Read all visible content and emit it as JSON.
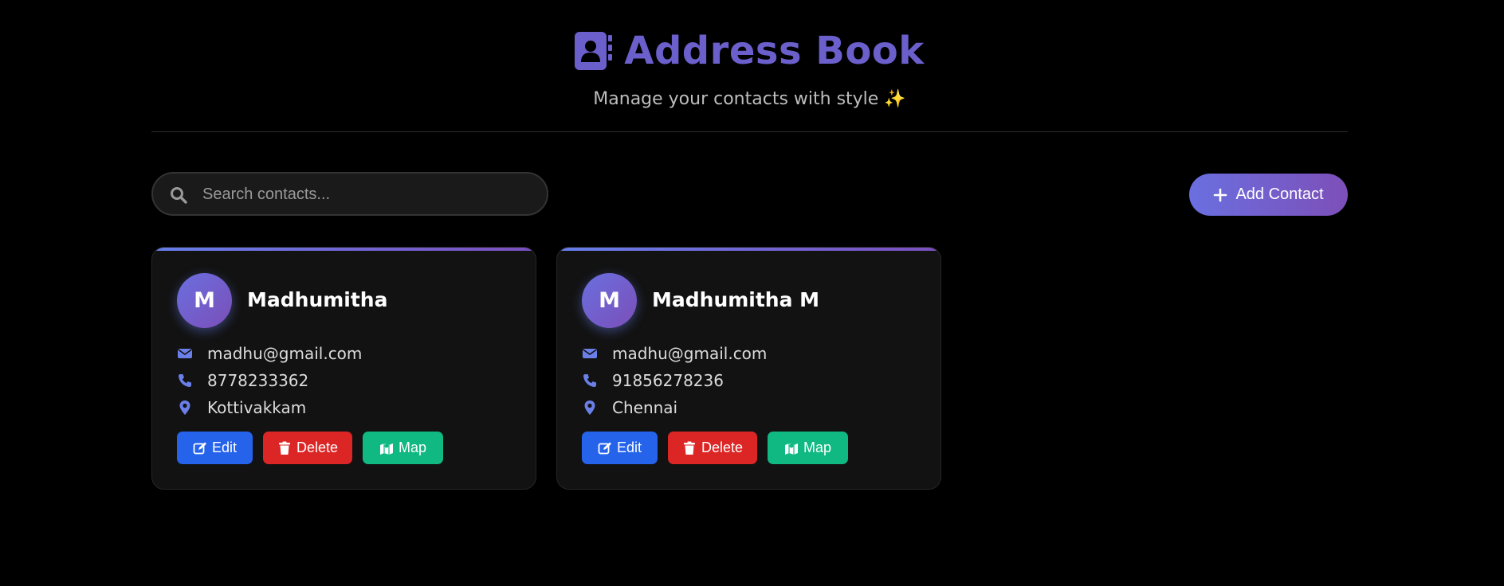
{
  "header": {
    "title": "Address Book",
    "subtitle": "Manage your contacts with style ✨",
    "icon": "address-book-icon"
  },
  "search": {
    "placeholder": "Search contacts...",
    "value": "",
    "icon": "search-icon"
  },
  "toolbar": {
    "add_label": "Add Contact"
  },
  "colors": {
    "accent": "#6b5fcb",
    "edit": "#2563eb",
    "delete": "#dc2626",
    "map": "#10b981",
    "info_icon": "#6a7fe8"
  },
  "contacts": [
    {
      "initial": "M",
      "name": "Madhumitha",
      "email": "madhu@gmail.com",
      "phone": "8778233362",
      "location": "Kottivakkam",
      "edit_label": "Edit",
      "delete_label": "Delete",
      "map_label": "Map"
    },
    {
      "initial": "M",
      "name": "Madhumitha M",
      "email": "madhu@gmail.com",
      "phone": "91856278236",
      "location": "Chennai",
      "edit_label": "Edit",
      "delete_label": "Delete",
      "map_label": "Map"
    }
  ]
}
